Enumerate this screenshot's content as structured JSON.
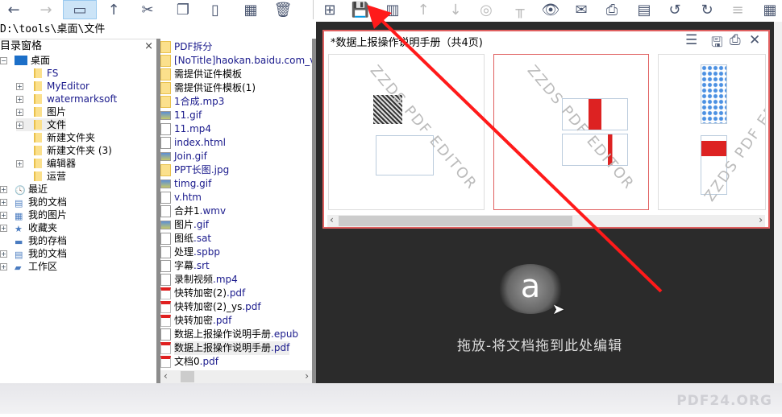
{
  "toolbar": {
    "left": [
      "back-icon",
      "forward-icon",
      "window-icon",
      "up-icon",
      "cut-icon",
      "copy-icon",
      "paste-icon",
      "grid-icon",
      "delete-icon"
    ],
    "right": [
      "new-page-icon",
      "save-icon",
      "trash-icon",
      "arrow-up-icon",
      "arrow-down-icon",
      "rings-icon",
      "ruler-icon",
      "eye-icon",
      "mail-icon",
      "print-icon",
      "fax-icon",
      "rotate-left-icon",
      "rotate-right-icon",
      "align-icon",
      "apps-icon"
    ]
  },
  "path": "D:\\tools\\桌面\\文件",
  "tree": {
    "title": "目录窗格",
    "close": "×",
    "items": [
      {
        "label": "桌面",
        "level": 0
      },
      {
        "label": "FS",
        "level": 1
      },
      {
        "label": "MyEditor",
        "level": 1
      },
      {
        "label": "watermarksoft",
        "level": 1
      },
      {
        "label": "图片",
        "level": 1
      },
      {
        "label": "文件",
        "level": 1
      },
      {
        "label": "新建文件夹",
        "level": 1
      },
      {
        "label": "新建文件夹 (3)",
        "level": 1
      },
      {
        "label": "编辑器",
        "level": 1
      },
      {
        "label": "运营",
        "level": 1
      },
      {
        "label": "最近",
        "level": 0
      },
      {
        "label": "我的文档",
        "level": 0
      },
      {
        "label": "我的图片",
        "level": 0
      },
      {
        "label": "收藏夹",
        "level": 0
      },
      {
        "label": "我的存档",
        "level": 0
      },
      {
        "label": "我的文档",
        "level": 0
      },
      {
        "label": "工作区",
        "level": 0
      }
    ]
  },
  "files": [
    {
      "name": "PDF拆分",
      "ext": "",
      "type": "folder"
    },
    {
      "name": "[NoTitle]haokan.baidu.com_v_",
      "ext": "",
      "type": "folder"
    },
    {
      "name": "需提供证件模板",
      "ext": "",
      "type": "folder"
    },
    {
      "name": "需提供证件模板(1)",
      "ext": "",
      "type": "folder"
    },
    {
      "name": "1合成",
      "ext": ".mp3",
      "type": "folder"
    },
    {
      "name": "11",
      "ext": ".gif",
      "type": "img"
    },
    {
      "name": "11",
      "ext": ".mp4",
      "type": "file"
    },
    {
      "name": "index",
      "ext": ".html",
      "type": "file"
    },
    {
      "name": "Join",
      "ext": ".gif",
      "type": "img"
    },
    {
      "name": "PPT长图",
      "ext": ".jpg",
      "type": "folder"
    },
    {
      "name": "timg",
      "ext": ".gif",
      "type": "img"
    },
    {
      "name": "v",
      "ext": ".htm",
      "type": "file"
    },
    {
      "name": "合并1",
      "ext": ".wmv",
      "type": "file"
    },
    {
      "name": "图片",
      "ext": ".gif",
      "type": "img"
    },
    {
      "name": "图纸",
      "ext": ".sat",
      "type": "file"
    },
    {
      "name": "处理",
      "ext": ".spbp",
      "type": "file"
    },
    {
      "name": "字幕",
      "ext": ".srt",
      "type": "file"
    },
    {
      "name": "录制视频",
      "ext": ".mp4",
      "type": "file"
    },
    {
      "name": "快转加密(2)",
      "ext": ".pdf",
      "type": "pdf"
    },
    {
      "name": "快转加密(2)_ys",
      "ext": ".pdf",
      "type": "pdf"
    },
    {
      "name": "快转加密",
      "ext": ".pdf",
      "type": "pdf"
    },
    {
      "name": "数据上报操作说明手册",
      "ext": ".epub",
      "type": "file"
    },
    {
      "name": "数据上报操作说明手册",
      "ext": ".pdf",
      "type": "pdf",
      "selected": true
    },
    {
      "name": "文档0",
      "ext": ".pdf",
      "type": "pdf"
    }
  ],
  "document": {
    "title": "*数据上报操作说明手册（共4页)",
    "watermark": "ZZDS PDF EDITOR"
  },
  "drop_text": "拖放-将文档拖到此处编辑",
  "logo_letter": "a",
  "brand": "PDF24.ORG",
  "annotation_color": "#ff1a1a"
}
